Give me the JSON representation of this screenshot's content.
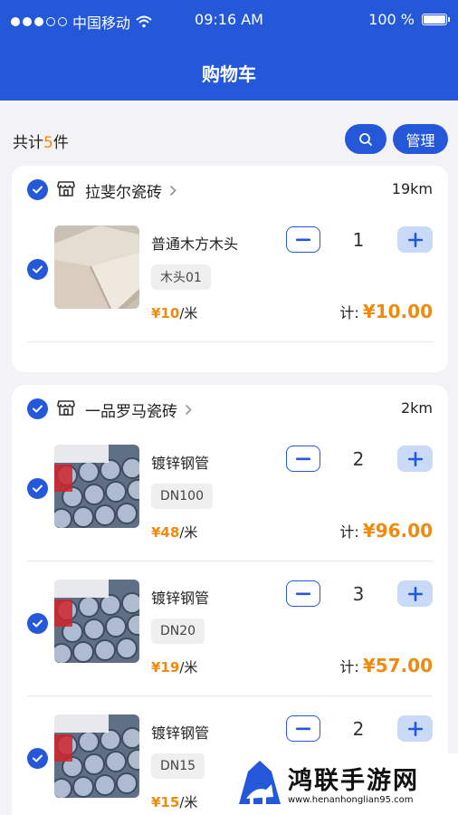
{
  "status_bar": {
    "carrier": "中国移动",
    "time": "09:16 AM",
    "battery": "100 %",
    "battery_level": 1.0
  },
  "header": {
    "title": "购物车"
  },
  "summary": {
    "prefix": "共计",
    "count": "5",
    "suffix": "件"
  },
  "toolbar": {
    "manage_label": "管理"
  },
  "subtotal_label": "计:",
  "shops": [
    {
      "name": "拉斐尔瓷砖",
      "distance": "19km",
      "items": [
        {
          "name": "普通木方木头",
          "spec": "木头01",
          "price": "¥10",
          "unit": "/米",
          "quantity": "1",
          "subtotal": "¥10.00"
        }
      ]
    },
    {
      "name": "一品罗马瓷砖",
      "distance": "2km",
      "items": [
        {
          "name": "镀锌钢管",
          "spec": "DN100",
          "price": "¥48",
          "unit": "/米",
          "quantity": "2",
          "subtotal": "¥96.00"
        },
        {
          "name": "镀锌钢管",
          "spec": "DN20",
          "price": "¥19",
          "unit": "/米",
          "quantity": "3",
          "subtotal": "¥57.00"
        },
        {
          "name": "镀锌钢管",
          "spec": "DN15",
          "price": "¥15",
          "unit": "/米",
          "quantity": "2",
          "subtotal": ""
        }
      ]
    }
  ],
  "watermark": {
    "text": "鸿联手游网",
    "url": "www.henanhonglian95.com"
  },
  "colors": {
    "primary": "#2458d9",
    "accent": "#f08a0c",
    "plus_bg": "#c8daf8"
  }
}
